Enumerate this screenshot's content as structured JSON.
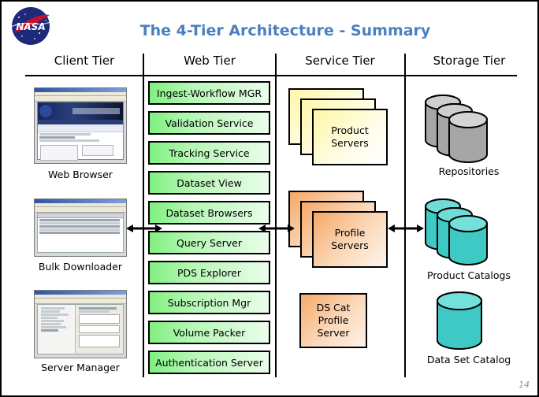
{
  "slide": {
    "title": "The 4-Tier Architecture - Summary",
    "page_number": "14",
    "title_color": "#4a80bf",
    "page_number_color": "#6f9fc4",
    "logo_alt": "NASA"
  },
  "tiers": [
    {
      "label": "Client Tier"
    },
    {
      "label": "Web Tier"
    },
    {
      "label": "Service Tier"
    },
    {
      "label": "Storage Tier"
    }
  ],
  "client_tier": {
    "items": [
      {
        "caption": "Web Browser",
        "screenshot": "web-browser-screenshot"
      },
      {
        "caption": "Bulk Downloader",
        "screenshot": "bulk-downloader-screenshot"
      },
      {
        "caption": "Server Manager",
        "screenshot": "server-manager-screenshot"
      }
    ]
  },
  "web_tier": {
    "color": "#7ff07f",
    "boxes": [
      {
        "label": "Ingest-Workflow MGR"
      },
      {
        "label": "Validation Service"
      },
      {
        "label": "Tracking Service"
      },
      {
        "label": "Dataset View"
      },
      {
        "label": "Dataset Browsers"
      },
      {
        "label": "Query Server"
      },
      {
        "label": "PDS Explorer"
      },
      {
        "label": "Subscription Mgr"
      },
      {
        "label": "Volume Packer"
      },
      {
        "label": "Authentication Server"
      }
    ]
  },
  "service_tier": {
    "product_servers": {
      "line1": "Product",
      "line2": "Servers",
      "color": "#fff7a8",
      "stacked": true
    },
    "profile_servers": {
      "line1": "Profile",
      "line2": "Servers",
      "color": "#f5a868",
      "stacked": true
    },
    "ds_cat_profile_server": {
      "line1": "DS Cat",
      "line2": "Profile",
      "line3": "Server",
      "color": "#f5a868",
      "stacked": false
    }
  },
  "storage_tier": {
    "items": [
      {
        "caption": "Repositories",
        "color": "#a6a6a6",
        "count": 3
      },
      {
        "caption": "Product Catalogs",
        "color": "#4ecdc8",
        "count": 3
      },
      {
        "caption": "Data Set Catalog",
        "color": "#4ecdc8",
        "count": 1
      }
    ]
  }
}
